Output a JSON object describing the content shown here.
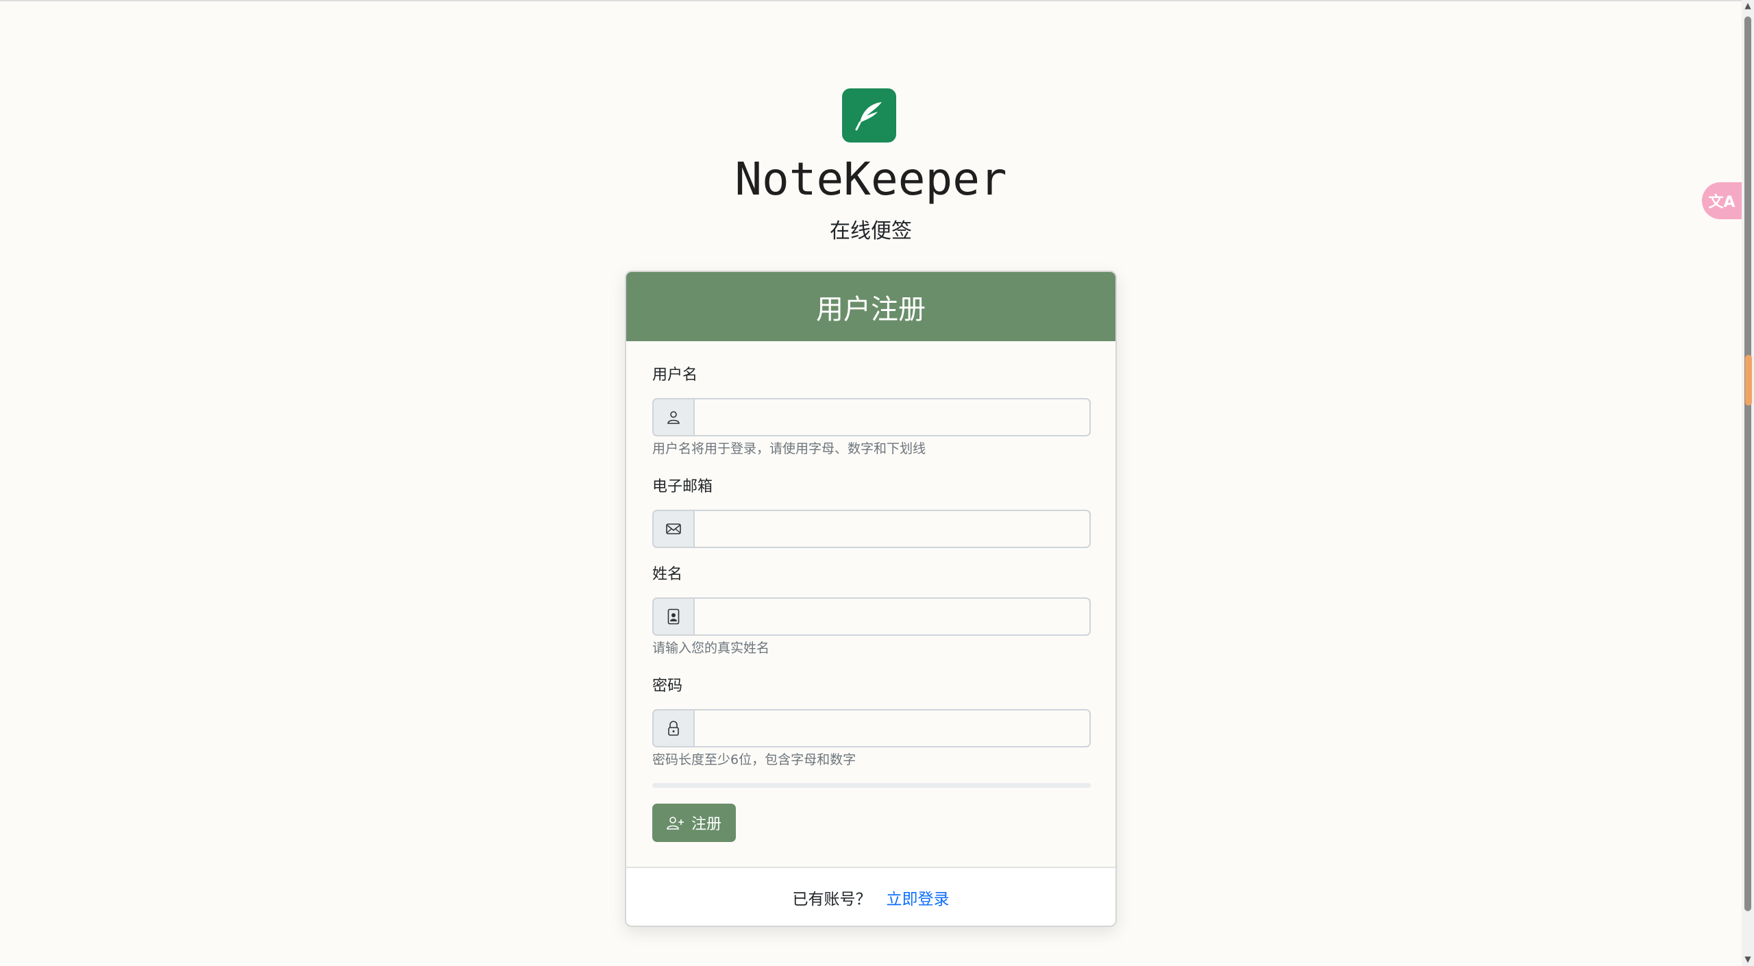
{
  "brand": {
    "title": "NoteKeeper",
    "subtitle": "在线便签",
    "logo_icon": "feather-icon",
    "color": "#1a8a57"
  },
  "card": {
    "title": "用户注册",
    "header_color": "#6a8e6a"
  },
  "form": {
    "username": {
      "label": "用户名",
      "icon": "person-icon",
      "value": "",
      "help": "用户名将用于登录，请使用字母、数字和下划线"
    },
    "email": {
      "label": "电子邮箱",
      "icon": "envelope-icon",
      "value": ""
    },
    "fullname": {
      "label": "姓名",
      "icon": "contact-card-icon",
      "value": "",
      "help": "请输入您的真实姓名"
    },
    "password": {
      "label": "密码",
      "icon": "lock-icon",
      "value": "",
      "help": "密码长度至少6位，包含字母和数字"
    },
    "password_strength": 0,
    "submit_label": "注册",
    "submit_icon": "person-plus-icon"
  },
  "footer": {
    "prompt": "已有账号？",
    "login_link": "立即登录",
    "link_color": "#0d6efd"
  },
  "translate_widget": {
    "icon": "translate-icon",
    "color": "#f6a9c4"
  }
}
